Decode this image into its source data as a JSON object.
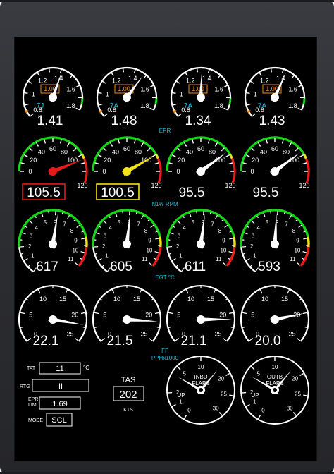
{
  "epr": {
    "label": "EPR",
    "gauges": [
      {
        "value": 1.41,
        "readout": "1.41",
        "rating": "7J",
        "target": "1.00"
      },
      {
        "value": 1.48,
        "readout": "1.48",
        "rating": "7A",
        "target": "1.00"
      },
      {
        "value": 1.34,
        "readout": "1.34",
        "rating": "7A",
        "target": "1.00"
      },
      {
        "value": 1.43,
        "readout": "1.43",
        "rating": "7A",
        "target": "1.00"
      }
    ],
    "scale_labels": [
      "0.8",
      "1",
      "1.2",
      "1.4",
      "1.6",
      "1.8"
    ],
    "min": 0.8,
    "max": 1.8
  },
  "n1": {
    "label": "N1% RPM",
    "gauges": [
      {
        "value": 105.5,
        "readout": "105.5",
        "needle_color": "#e81a1a",
        "box_color": "#e81a1a"
      },
      {
        "value": 100.5,
        "readout": "100.5",
        "needle_color": "#f2e21a",
        "box_color": "#f2e21a"
      },
      {
        "value": 95.5,
        "readout": "95.5",
        "needle_color": "#ffffff",
        "box_color": ""
      },
      {
        "value": 95.5,
        "readout": "95.5",
        "needle_color": "#ffffff",
        "box_color": ""
      }
    ],
    "scale_labels": [
      "0",
      "20",
      "40",
      "60",
      "80",
      "100",
      "120"
    ],
    "min": 0,
    "max": 120
  },
  "egt": {
    "label": "EGT °C",
    "gauges": [
      {
        "value": 6.17,
        "readout": "617"
      },
      {
        "value": 6.05,
        "readout": "605"
      },
      {
        "value": 6.11,
        "readout": "611"
      },
      {
        "value": 5.93,
        "readout": "593"
      }
    ],
    "scale_labels": [
      "0",
      "1",
      "2",
      "3",
      "4",
      "5",
      "6",
      "7",
      "8",
      "9",
      "10",
      "11"
    ],
    "min": 0,
    "max": 11
  },
  "ff": {
    "label": "FF",
    "sublabel": "PPHx1000",
    "gauges": [
      {
        "value": 22.1,
        "readout": "22.1"
      },
      {
        "value": 21.5,
        "readout": "21.5"
      },
      {
        "value": 21.1,
        "readout": "21.1"
      },
      {
        "value": 20.0,
        "readout": "20.0"
      }
    ],
    "scale_labels": [
      "0",
      "5",
      "10",
      "15",
      "20",
      "25"
    ],
    "min": 0,
    "max": 25
  },
  "info": {
    "tat_label": "TAT",
    "tat_value": "11",
    "tat_unit": "°C",
    "rtg_label": "RTG",
    "rtg_value": "II",
    "epr_lim_label_1": "EPR",
    "epr_lim_label_2": "LIM",
    "epr_lim_value": "1.69",
    "mode_label": "MODE",
    "mode_value": "SCL"
  },
  "tas": {
    "label": "TAS",
    "value": "202",
    "unit": "KTS"
  },
  "flaps": {
    "inbd_label_1": "INBD",
    "inbd_label_2": "FLAPS",
    "outbd_label_1": "OUTB",
    "outbd_label_2": "FLAPS",
    "scale_labels": [
      "0",
      "1",
      "2",
      "5",
      "10",
      "20",
      "25",
      "30"
    ],
    "up_label": "UP"
  },
  "colors": {
    "green": "#16d416",
    "yellow": "#f2e21a",
    "red": "#e81a1a",
    "cyan": "#22b8d8",
    "orange": "#f08a1a"
  }
}
